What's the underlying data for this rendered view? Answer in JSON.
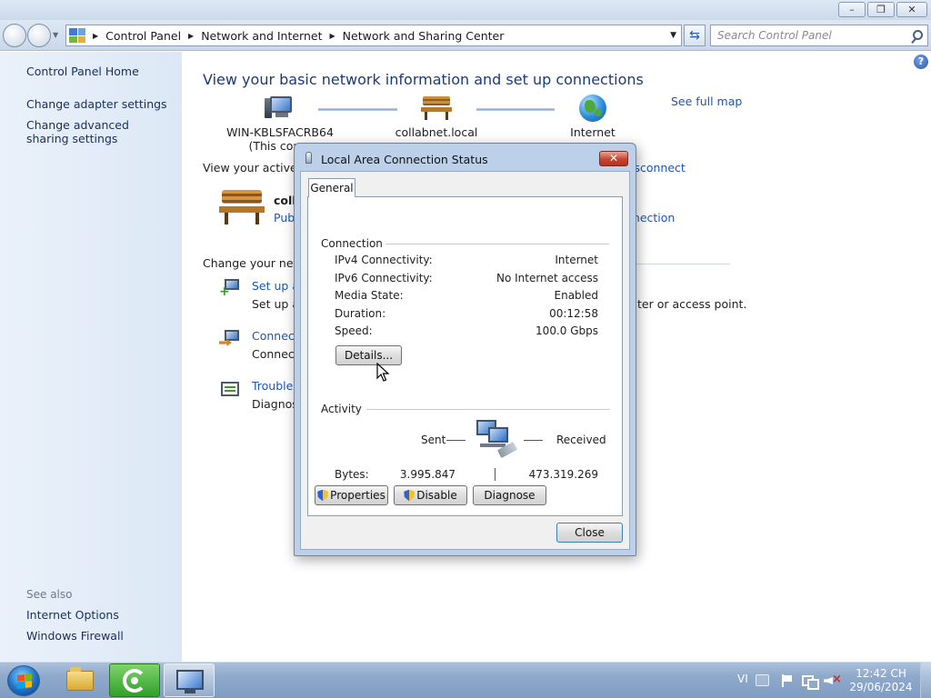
{
  "window": {
    "minimize": "–",
    "restore": "❐",
    "close": "✕"
  },
  "addressbar": {
    "crumbs": [
      "Control Panel",
      "Network and Internet",
      "Network and Sharing Center"
    ]
  },
  "search": {
    "placeholder": "Search Control Panel"
  },
  "sidebar": {
    "home": "Control Panel Home",
    "items": [
      "Change adapter settings",
      "Change advanced sharing settings"
    ],
    "see_also_title": "See also",
    "see_also": [
      "Internet Options",
      "Windows Firewall"
    ]
  },
  "main": {
    "help": "?",
    "title": "View your basic network information and set up connections",
    "see_full_map": "See full map",
    "map": {
      "computer": "WIN-KBLSFACRB64",
      "computer_sub": "(This comp",
      "network": "collabnet.local",
      "internet": "Internet"
    },
    "active_heading": "View your active ne",
    "connect_disconnect": "nnect or disconnect",
    "network_name": "colla",
    "network_type": "Pub",
    "network_connection": "nnection",
    "change_heading": "Change your netw",
    "tasks": [
      {
        "link": "Set up a",
        "desc": "Set up a",
        "desc_tail": "ter or access point."
      },
      {
        "link": "Connect",
        "desc": "Connect"
      },
      {
        "link": "Troubles",
        "desc": "Diagnose"
      }
    ]
  },
  "dialog": {
    "title": "Local Area Connection Status",
    "close": "✕",
    "tab": "General",
    "connection_group": "Connection",
    "rows": [
      {
        "label": "IPv4 Connectivity:",
        "value": "Internet"
      },
      {
        "label": "IPv6 Connectivity:",
        "value": "No Internet access"
      },
      {
        "label": "Media State:",
        "value": "Enabled"
      },
      {
        "label": "Duration:",
        "value": "00:12:58"
      },
      {
        "label": "Speed:",
        "value": "100.0 Gbps"
      }
    ],
    "details_button": "Details...",
    "activity_group": "Activity",
    "sent_label": "Sent",
    "received_label": "Received",
    "bytes_label": "Bytes:",
    "bytes_sent": "3.995.847",
    "bytes_received": "473.319.269",
    "properties_button": "Properties",
    "disable_button": "Disable",
    "diagnose_button": "Diagnose",
    "close_button": "Close"
  },
  "taskbar": {
    "language": "VI",
    "time": "12:42 CH",
    "date": "29/06/2024"
  }
}
